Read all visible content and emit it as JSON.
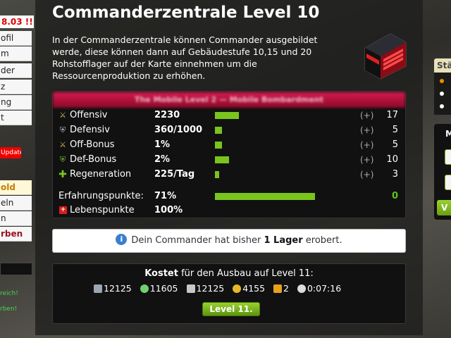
{
  "left_sidebar": {
    "alert_text": "8.03 !!",
    "menu_items": [
      "ofil",
      "m",
      "der",
      "z",
      "ng",
      "t"
    ],
    "update_label": "Update",
    "lower_items": [
      {
        "label": "old",
        "style": "gold"
      },
      {
        "label": "eln",
        "style": "normal"
      },
      {
        "label": "n",
        "style": "normal"
      },
      {
        "label": "rben",
        "style": "dark"
      }
    ],
    "green_messages": [
      "reich!",
      "rben!"
    ]
  },
  "right_sidebar": {
    "box_title": "Stä",
    "box2_title": "M",
    "green_button": "V",
    "dot_colors": [
      "#f08a00",
      "#ffffff",
      "#ffffff"
    ]
  },
  "page": {
    "title": "Commanderzentrale Level 10",
    "description": "In der Commanderzentrale können Commander ausgebildet werde, diese können dann auf Gebäudestufe 10,15 und 20 Rohstofflager auf der Karte einnehmen um die Ressourcenproduktion zu erhöhen.",
    "building_icon": "commander-center-icon"
  },
  "stats": {
    "header": "The Mobile Level 2 — Mobile Bombardment",
    "rows": [
      {
        "icon": "swords-icon",
        "label": "Offensiv",
        "value": "2230",
        "bar": 0.17,
        "plus": "(+)",
        "level": "17"
      },
      {
        "icon": "shield-icon",
        "label": "Defensiv",
        "value": "360/1000",
        "bar": 0.05,
        "plus": "(+)",
        "level": "5"
      },
      {
        "icon": "swords-icon",
        "label": "Off-Bonus",
        "value": "1%",
        "bar": 0.05,
        "plus": "(+)",
        "level": "5"
      },
      {
        "icon": "shield-icon",
        "label": "Def-Bonus",
        "value": "2%",
        "bar": 0.1,
        "plus": "(+)",
        "level": "10"
      },
      {
        "icon": "plus-icon",
        "label": "Regeneration",
        "value": "225/Tag",
        "bar": 0.03,
        "plus": "(+)",
        "level": "3"
      }
    ],
    "xp": {
      "label": "Erfahrungspunkte:",
      "value": "71%",
      "bar": 0.71,
      "level": "0"
    },
    "life": {
      "label": "Lebenspunkte",
      "value": "100%"
    }
  },
  "info": {
    "prefix": "Dein Commander hat bisher ",
    "bold": "1 Lager",
    "suffix": " erobert."
  },
  "cost": {
    "title_bold": "Kostet",
    "title_rest": " für den Ausbau auf Level 11:",
    "items": [
      {
        "icon": "metal-icon",
        "value": "12125",
        "color": "#9aa6b4"
      },
      {
        "icon": "crystal-icon",
        "value": "11605",
        "color": "#6fd06f"
      },
      {
        "icon": "stone-icon",
        "value": "12125",
        "color": "#c8c8c8"
      },
      {
        "icon": "gold-icon",
        "value": "4155",
        "color": "#e8b828"
      },
      {
        "icon": "points-icon",
        "value": "2",
        "color": "#e8a020"
      },
      {
        "icon": "clock-icon",
        "value": "0:07:16",
        "color": "#dddddd"
      }
    ],
    "button": "Level 11."
  }
}
